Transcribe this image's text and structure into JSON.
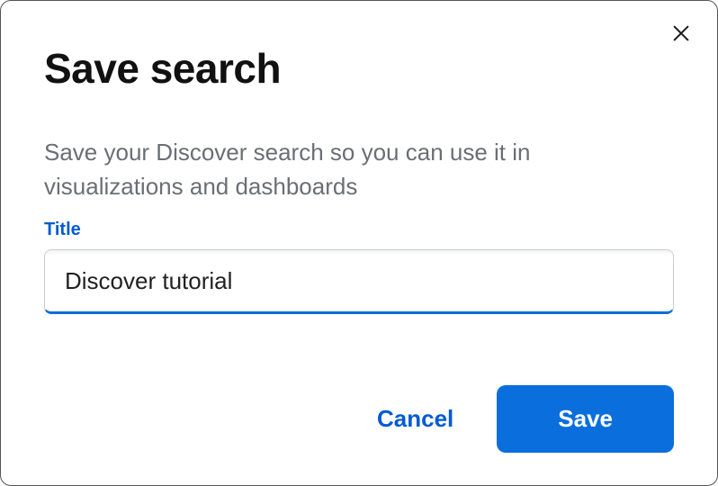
{
  "modal": {
    "title": "Save search",
    "description": "Save your Discover search so you can use it in visualizations and dashboards",
    "field": {
      "label": "Title",
      "value": "Discover tutorial"
    },
    "buttons": {
      "cancel": "Cancel",
      "save": "Save"
    }
  }
}
